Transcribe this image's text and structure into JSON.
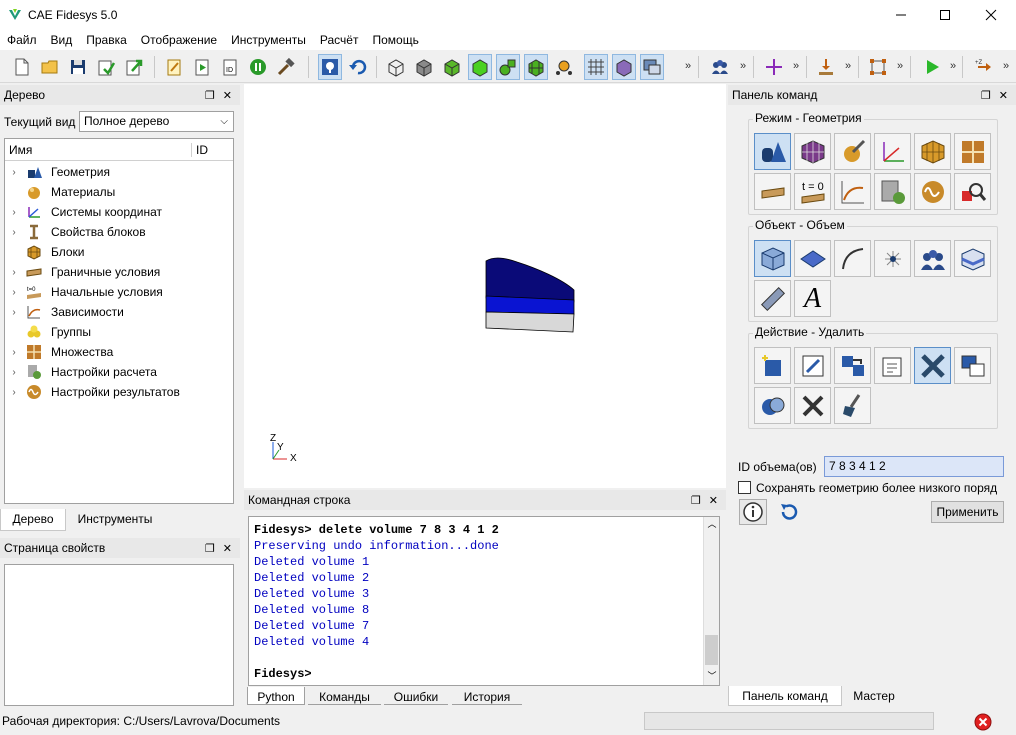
{
  "window": {
    "title": "CAE Fidesys 5.0",
    "minimize_icon": "minimize-icon",
    "maximize_icon": "maximize-icon",
    "close_icon": "close-icon"
  },
  "menu": [
    "Файл",
    "Вид",
    "Правка",
    "Отображение",
    "Инструменты",
    "Расчёт",
    "Помощь"
  ],
  "toolbar": {
    "more_glyph": "»"
  },
  "tree_panel": {
    "title": "Дерево",
    "current_view_label": "Текущий вид",
    "current_view_value": "Полное дерево",
    "col_name": "Имя",
    "col_id": "ID",
    "items": [
      {
        "label": "Геометрия",
        "icon": "geometry-icon",
        "arrow": true
      },
      {
        "label": "Материалы",
        "icon": "materials-icon",
        "arrow": false
      },
      {
        "label": "Системы координат",
        "icon": "coordinate-systems-icon",
        "arrow": true
      },
      {
        "label": "Свойства блоков",
        "icon": "block-properties-icon",
        "arrow": true
      },
      {
        "label": "Блоки",
        "icon": "blocks-icon",
        "arrow": false
      },
      {
        "label": "Граничные условия",
        "icon": "boundary-conditions-icon",
        "arrow": true
      },
      {
        "label": "Начальные условия",
        "icon": "initial-conditions-icon",
        "arrow": true
      },
      {
        "label": "Зависимости",
        "icon": "dependencies-icon",
        "arrow": true
      },
      {
        "label": "Группы",
        "icon": "groups-icon",
        "arrow": false
      },
      {
        "label": "Множества",
        "icon": "sets-icon",
        "arrow": true
      },
      {
        "label": "Настройки расчета",
        "icon": "calc-settings-icon",
        "arrow": true
      },
      {
        "label": "Настройки результатов",
        "icon": "result-settings-icon",
        "arrow": true
      }
    ],
    "tabs": [
      "Дерево",
      "Инструменты"
    ],
    "icon_label_t0": "t=0"
  },
  "props_panel": {
    "title": "Страница свойств"
  },
  "viewport": {
    "axis_z": "Z",
    "axis_y": "Y",
    "axis_x": "X"
  },
  "command_line": {
    "title": "Командная строка",
    "lines": [
      {
        "text": "Fidesys> delete volume 7 8 3 4 1 2",
        "style": "bold"
      },
      {
        "text": "Preserving undo information...done",
        "style": "blue"
      },
      {
        "text": "Deleted volume 1",
        "style": "blue"
      },
      {
        "text": "Deleted volume 2",
        "style": "blue"
      },
      {
        "text": "Deleted volume 3",
        "style": "blue"
      },
      {
        "text": "Deleted volume 8",
        "style": "blue"
      },
      {
        "text": "Deleted volume 7",
        "style": "blue"
      },
      {
        "text": "Deleted volume 4",
        "style": "blue"
      },
      {
        "text": "",
        "style": ""
      },
      {
        "text": "Fidesys>",
        "style": "bold"
      }
    ],
    "tabs": [
      "Python",
      "Команды",
      "Ошибки",
      "История"
    ]
  },
  "command_panel": {
    "title": "Панель команд",
    "mode_group": "Режим - Геометрия",
    "object_group": "Объект - Объем",
    "action_group": "Действие - Удалить",
    "t0_label": "t = 0",
    "italic_a": "A",
    "id_label": "ID объема(ов)",
    "id_value": "7 8 3 4 1 2",
    "keep_geometry_label": "Сохранять геометрию более низкого поряд",
    "apply_label": "Применить",
    "tabs": [
      "Панель команд",
      "Мастер"
    ]
  },
  "status": {
    "workdir": "Рабочая директория: C:/Users/Lavrova/Documents"
  },
  "colors": {
    "accent_blue": "#0000c0",
    "solid_dark_blue": "#0a0a78",
    "solid_mid_blue": "#0a14d2",
    "solid_gray": "#d8d8d8",
    "active_fill": "#cde0f3"
  }
}
